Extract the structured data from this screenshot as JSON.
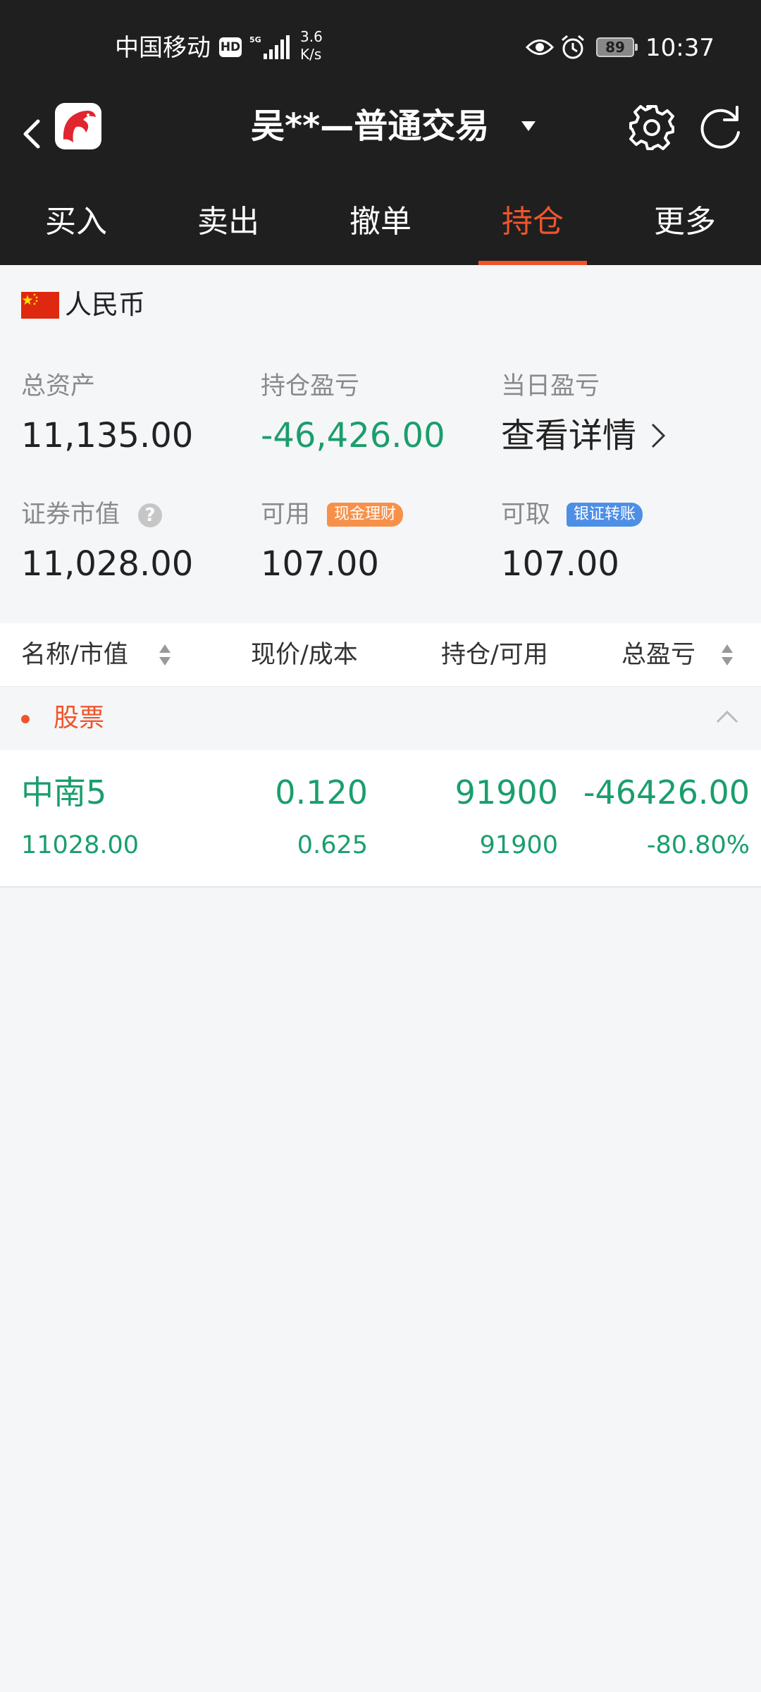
{
  "status_bar": {
    "carrier": "中国移动",
    "hd": "HD",
    "net_speed_value": "3.6",
    "net_speed_unit": "K/s",
    "battery": "89",
    "time": "10:37"
  },
  "header": {
    "account_title": "吴**—普通交易"
  },
  "tabs": [
    {
      "label": "买入",
      "active": false
    },
    {
      "label": "卖出",
      "active": false
    },
    {
      "label": "撤单",
      "active": false
    },
    {
      "label": "持仓",
      "active": true
    },
    {
      "label": "更多",
      "active": false
    }
  ],
  "summary": {
    "currency": "人民币",
    "total_assets": {
      "label": "总资产",
      "value": "11,135.00"
    },
    "position_pl": {
      "label": "持仓盈亏",
      "value": "-46,426.00"
    },
    "daily_pl": {
      "label": "当日盈亏",
      "link": "查看详情"
    },
    "market_value": {
      "label": "证券市值",
      "value": "11,028.00"
    },
    "available": {
      "label": "可用",
      "badge": "现金理财",
      "value": "107.00"
    },
    "withdrawable": {
      "label": "可取",
      "badge": "银证转账",
      "value": "107.00"
    }
  },
  "table": {
    "headers": [
      "名称/市值",
      "现价/成本",
      "持仓/可用",
      "总盈亏"
    ],
    "group": "股票",
    "rows": [
      {
        "name": "中南5",
        "market_value": "11028.00",
        "price": "0.120",
        "cost": "0.625",
        "holding": "91900",
        "available": "91900",
        "total_pl": "-46426.00",
        "total_pl_pct": "-80.80%"
      }
    ]
  },
  "colors": {
    "accent": "#f0542b",
    "loss_green": "#1a9e6c",
    "header_bg": "#1f1f1f",
    "badge_orange": "#f7914a",
    "badge_blue": "#4e8fe6"
  }
}
